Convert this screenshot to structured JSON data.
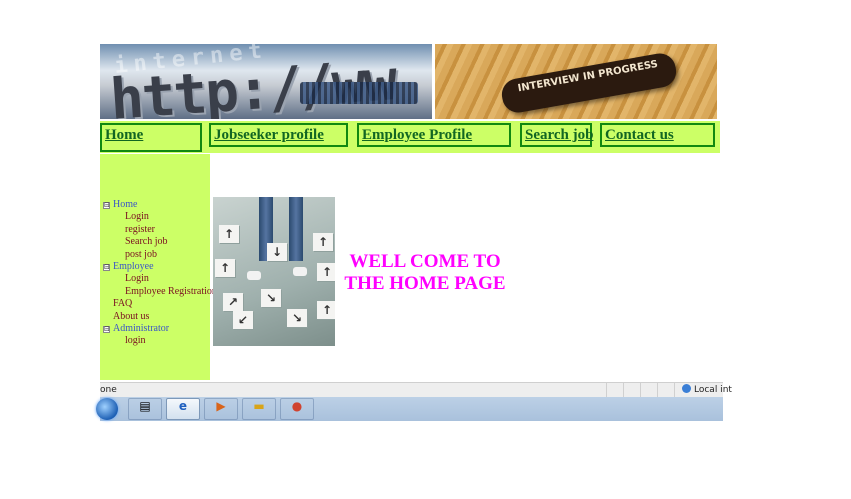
{
  "banner": {
    "left_faded_text": "internet",
    "left_url_text": "http://ww",
    "right_sign_text": "INTERVIEW IN PROGRESS"
  },
  "nav": {
    "home": "Home",
    "jobseeker_profile": "Jobseeker profile",
    "employee_profile": "Employee Profile",
    "search_job": "Search job",
    "contact_us": "Contact us"
  },
  "sidebar": {
    "tree": {
      "home": "Home",
      "login": "Login",
      "register": "register",
      "search_job": "Search job",
      "post_job": "post job",
      "employee": "Employee",
      "employee_login": "Login",
      "employee_registration": "Employee Registration",
      "faq": "FAQ",
      "about_us": "About us",
      "administrator": "Administrator",
      "admin_login": "login"
    },
    "toggle_symbol": "⊟"
  },
  "main": {
    "welcome_line1": "WELL COME TO",
    "welcome_line2": "THE HOME PAGE"
  },
  "statusbar": {
    "left_text": "one",
    "zone_text": "Local int"
  },
  "taskbar": {
    "icons": [
      "windows-start-icon",
      "document-icon",
      "internet-explorer-icon",
      "media-player-icon",
      "folder-icon",
      "paint-icon"
    ]
  },
  "colors": {
    "nav_background": "#ccff66",
    "nav_border": "#118811",
    "welcome_text": "#ff00ff",
    "tree_parent": "#3a56c8",
    "tree_leaf": "#7a1020"
  }
}
